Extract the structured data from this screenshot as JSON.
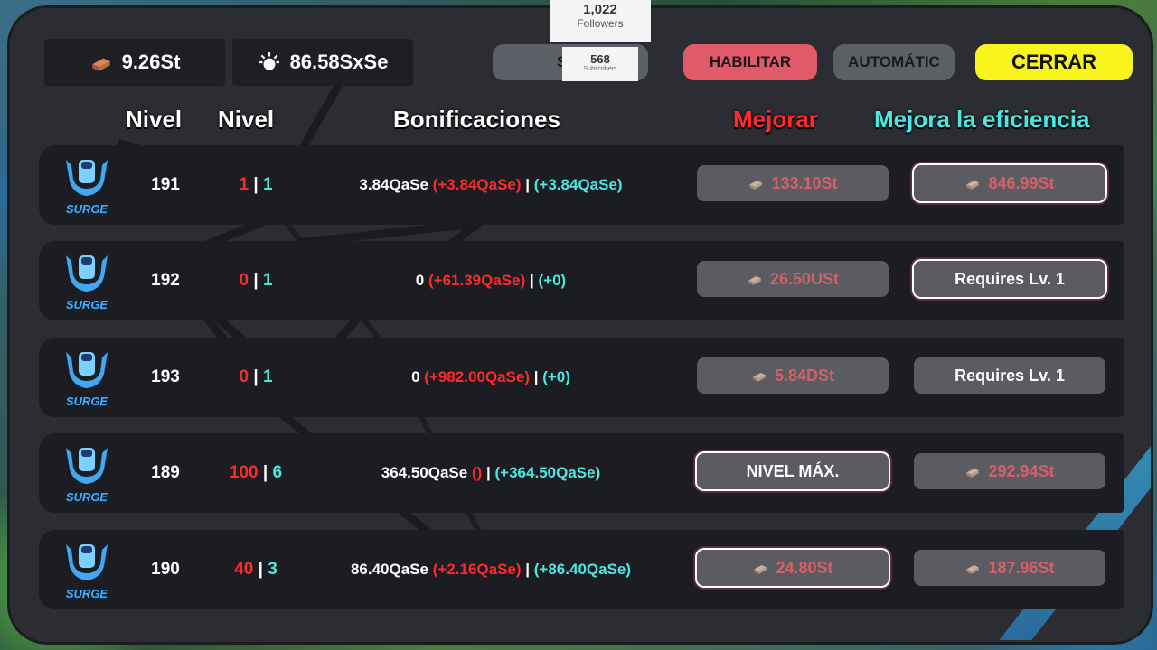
{
  "currencies": {
    "bricks": "9.26St",
    "energy": "86.58SxSe"
  },
  "overlay": {
    "followers_count": "1,022",
    "followers_label": "Followers",
    "subscribers_count": "568",
    "subscribers_label": "Subscribers"
  },
  "top_buttons": {
    "sim": "SIM",
    "habilitar": "HABILITAR",
    "automatic": "AUTOMÁTIC",
    "cerrar": "CERRAR"
  },
  "headers": {
    "level": "Nivel",
    "level2": "Nivel",
    "bonuses": "Bonificaciones",
    "upgrade": "Mejorar",
    "efficiency": "Mejora la eficiencia"
  },
  "icon_label": "SURGE",
  "colors": {
    "accent_red": "#ff2a2a",
    "accent_cyan": "#4de6e0",
    "close_yellow": "#f8f41c",
    "enable_pink": "#e05a6a"
  },
  "rows": [
    {
      "level": "191",
      "nv_red": "1",
      "sep": "|",
      "nv_cyan": "1",
      "bonus_base": "3.84QaSe",
      "bonus_red": "(+3.84QaSe)",
      "bonus_sep": "|",
      "bonus_cyan": "(+3.84QaSe)",
      "upgrade": "133.10St",
      "efficiency": "846.99St"
    },
    {
      "level": "192",
      "nv_red": "0",
      "sep": "|",
      "nv_cyan": "1",
      "bonus_base": "0",
      "bonus_red": "(+61.39QaSe)",
      "bonus_sep": "|",
      "bonus_cyan": "(+0)",
      "upgrade": "26.50USt",
      "efficiency": "Requires Lv. 1"
    },
    {
      "level": "193",
      "nv_red": "0",
      "sep": "|",
      "nv_cyan": "1",
      "bonus_base": "0",
      "bonus_red": "(+982.00QaSe)",
      "bonus_sep": "|",
      "bonus_cyan": "(+0)",
      "upgrade": "5.84DSt",
      "efficiency": "Requires Lv. 1"
    },
    {
      "level": "189",
      "nv_red": "100",
      "sep": "|",
      "nv_cyan": "6",
      "bonus_base": "364.50QaSe",
      "bonus_red": "()",
      "bonus_sep": "|",
      "bonus_cyan": "(+364.50QaSe)",
      "upgrade": "NIVEL MÁX.",
      "efficiency": "292.94St"
    },
    {
      "level": "190",
      "nv_red": "40",
      "sep": "|",
      "nv_cyan": "3",
      "bonus_base": "86.40QaSe",
      "bonus_red": "(+2.16QaSe)",
      "bonus_sep": "|",
      "bonus_cyan": "(+86.40QaSe)",
      "upgrade": "24.80St",
      "efficiency": "187.96St"
    }
  ]
}
